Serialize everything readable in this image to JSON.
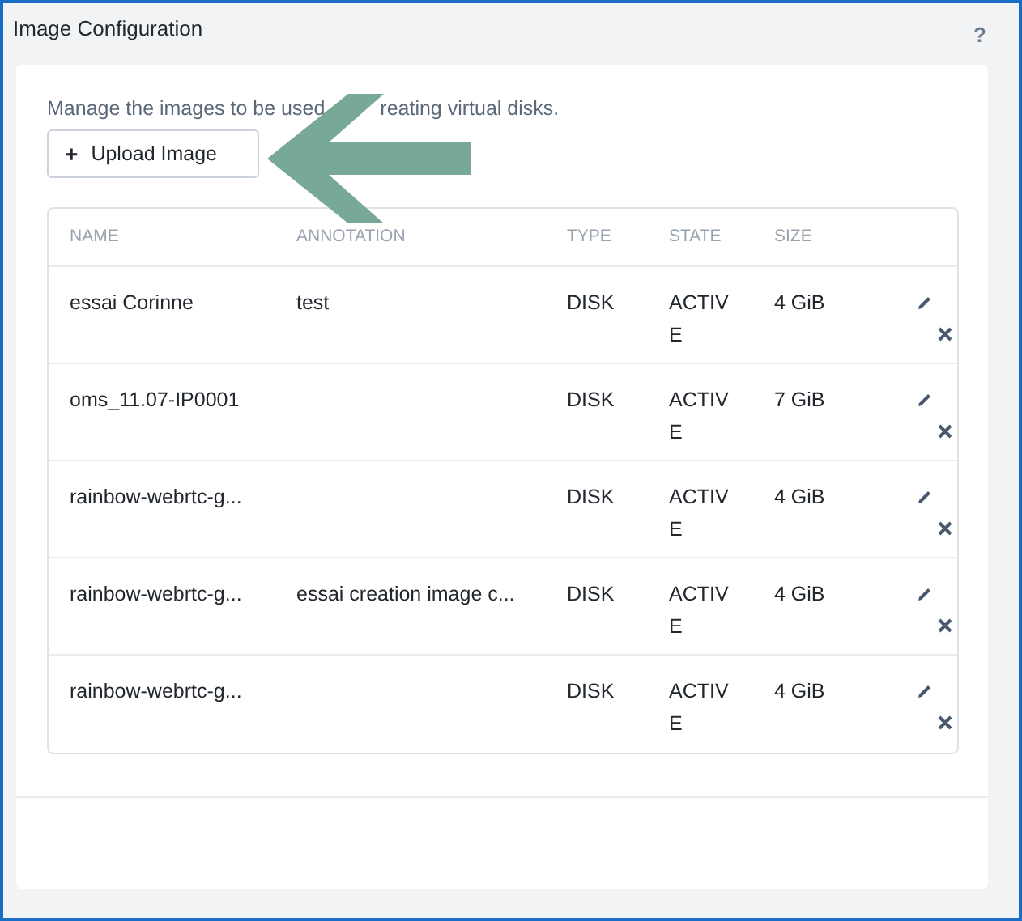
{
  "window": {
    "title": "Image Configuration",
    "help": "?"
  },
  "description": [
    "Manage the images to be used",
    "reating virtual disks."
  ],
  "upload_button": {
    "icon": "+",
    "label": "Upload Image"
  },
  "table": {
    "columns": [
      "NAME",
      "ANNOTATION",
      "TYPE",
      "STATE",
      "SIZE"
    ],
    "rows": [
      {
        "name": "essai Corinne",
        "annotation": "test",
        "type": "DISK",
        "state": "ACTIVE",
        "size": "4 GiB"
      },
      {
        "name": "oms_11.07-IP0001",
        "annotation": "",
        "type": "DISK",
        "state": "ACTIVE",
        "size": "7 GiB"
      },
      {
        "name": "rainbow-webrtc-g...",
        "annotation": "",
        "type": "DISK",
        "state": "ACTIVE",
        "size": "4 GiB"
      },
      {
        "name": "rainbow-webrtc-g...",
        "annotation": "essai creation image c...",
        "type": "DISK",
        "state": "ACTIVE",
        "size": "4 GiB"
      },
      {
        "name": "rainbow-webrtc-g...",
        "annotation": "",
        "type": "DISK",
        "state": "ACTIVE",
        "size": "4 GiB"
      }
    ]
  }
}
